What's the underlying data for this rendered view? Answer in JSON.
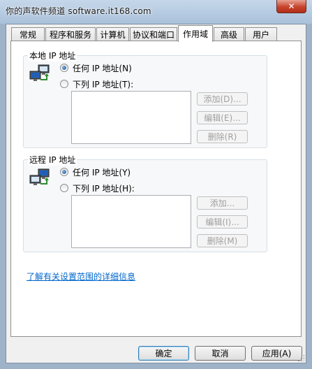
{
  "window": {
    "watermark": "你的声软件频道 software.it168.com",
    "close_glyph": "✕"
  },
  "tabs": [
    {
      "label": "常规"
    },
    {
      "label": "程序和服务"
    },
    {
      "label": "计算机"
    },
    {
      "label": "协议和端口"
    },
    {
      "label": "作用域"
    },
    {
      "label": "高级"
    },
    {
      "label": "用户"
    }
  ],
  "local": {
    "title": "本地 IP 地址",
    "any_label": "任何 IP 地址(N)",
    "list_label": "下列 IP 地址(T):",
    "add_label": "添加(D)...",
    "edit_label": "编辑(E)...",
    "remove_label": "删除(R)"
  },
  "remote": {
    "title": "远程 IP 地址",
    "any_label": "任何 IP 地址(Y)",
    "list_label": "下列 IP 地址(H):",
    "add_label": "添加...",
    "edit_label": "编辑(I)...",
    "remove_label": "删除(M)"
  },
  "link_text": "了解有关设置范围的详细信息",
  "buttons": {
    "ok": "确定",
    "cancel": "取消",
    "apply": "应用(A)"
  }
}
